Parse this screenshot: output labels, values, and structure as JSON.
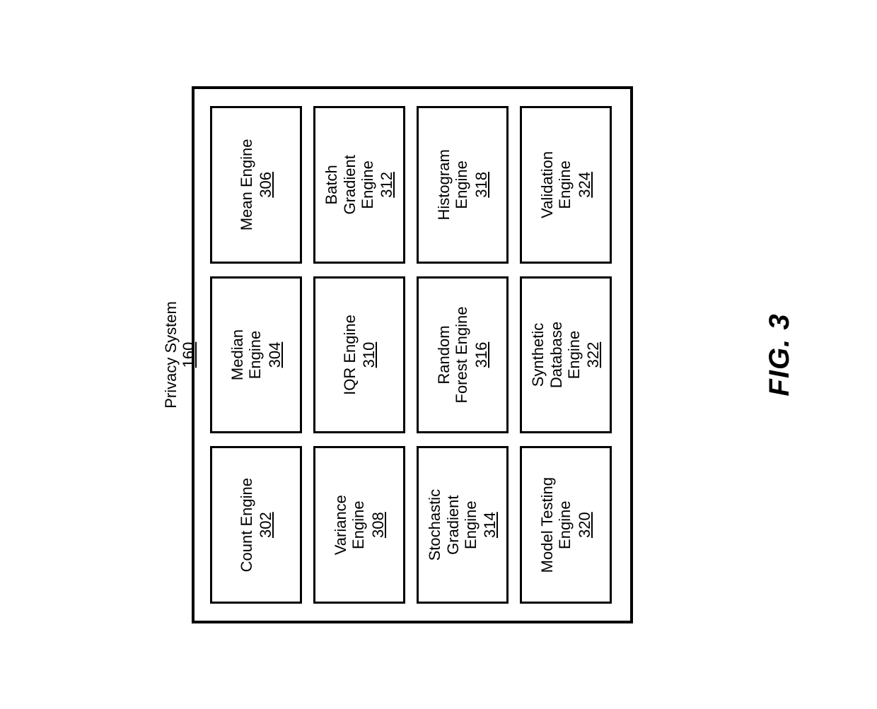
{
  "figure": {
    "caption": "FIG. 3",
    "system": {
      "title": "Privacy System",
      "ref": "160"
    },
    "engines": [
      {
        "name": "Count Engine",
        "ref": "302"
      },
      {
        "name": "Median\nEngine",
        "ref": "304"
      },
      {
        "name": "Mean Engine",
        "ref": "306"
      },
      {
        "name": "Variance\nEngine",
        "ref": "308"
      },
      {
        "name": "IQR Engine",
        "ref": "310"
      },
      {
        "name": "Batch\nGradient\nEngine",
        "ref": "312"
      },
      {
        "name": "Stochastic\nGradient\nEngine",
        "ref": "314"
      },
      {
        "name": "Random\nForest Engine",
        "ref": "316"
      },
      {
        "name": "Histogram\nEngine",
        "ref": "318"
      },
      {
        "name": "Model Testing\nEngine",
        "ref": "320"
      },
      {
        "name": "Synthetic\nDatabase\nEngine",
        "ref": "322"
      },
      {
        "name": "Validation\nEngine",
        "ref": "324"
      }
    ]
  }
}
